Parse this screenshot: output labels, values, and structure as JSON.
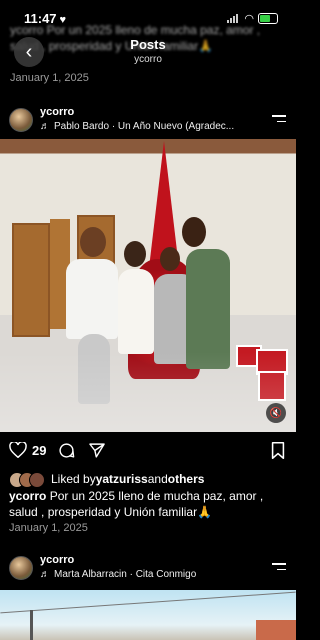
{
  "status": {
    "time": "11:47",
    "heart": "♥"
  },
  "header": {
    "title": "Posts",
    "subtitle": "ycorro",
    "back_icon": "chevron-left-icon"
  },
  "previous_post": {
    "caption_ghost": "ycorro Por un 2025 lleno de mucha paz, amor , salud , prosperidad y Unión familiar🙏",
    "date": "January 1, 2025"
  },
  "post1": {
    "username": "ycorro",
    "music_note": "♬",
    "music": "Pablo Bardo · Un Año Nuevo (Agradec...",
    "likes": "29",
    "liked_prefix": "Liked by ",
    "liked_user": "yatzuriss",
    "liked_mid": " and ",
    "liked_others": "others",
    "caption_user": "ycorro",
    "caption_text": " Por un 2025 lleno de mucha paz, amor , salud , prosperidad y  Unión familiar🙏",
    "date": "January 1, 2025"
  },
  "post2": {
    "username": "ycorro",
    "music_note": "♬",
    "music": "Marta Albarracin · Cita Conmigo"
  },
  "colors": {
    "background": "#000000",
    "text": "#ffffff",
    "muted": "#9a9a9a",
    "battery": "#37d046"
  }
}
